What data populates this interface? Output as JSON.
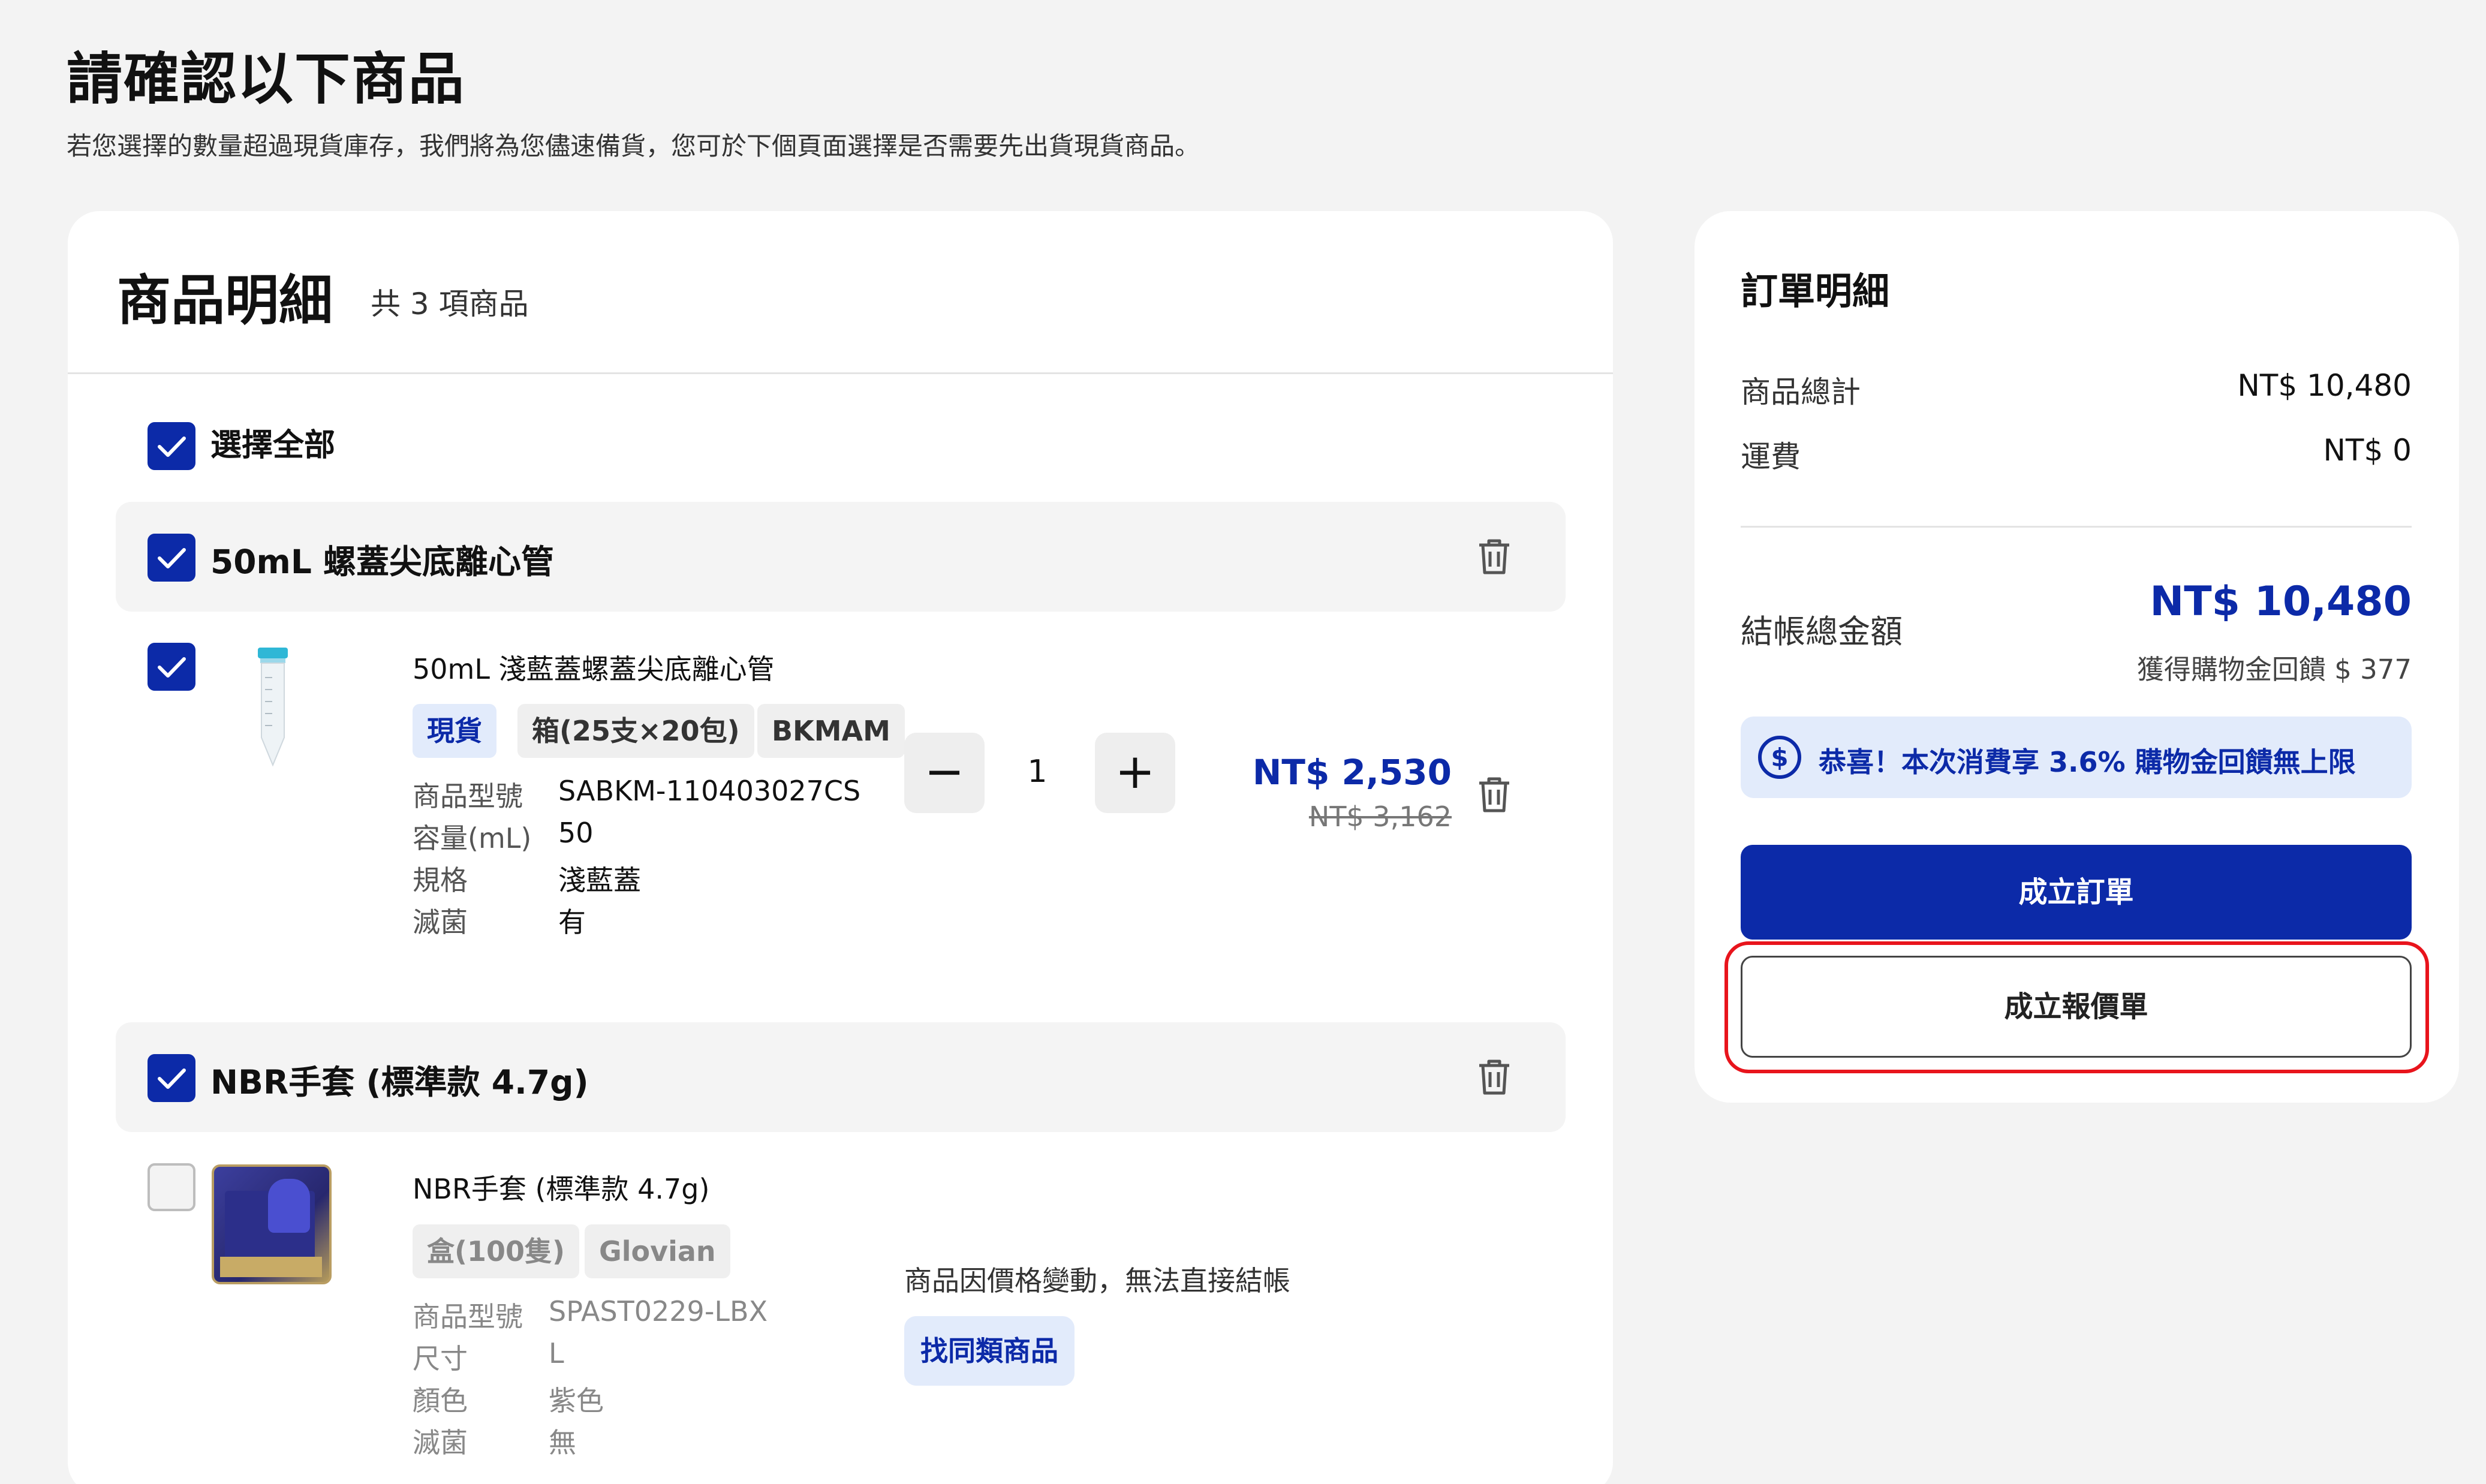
{
  "page": {
    "title": "請確認以下商品",
    "subtitle": "若您選擇的數量超過現貨庫存，我們將為您儘速備貨，您可於下個頁面選擇是否需要先出貨現貨商品。"
  },
  "cart": {
    "title": "商品明細",
    "count_text": "共 3 項商品",
    "select_all_label": "選擇全部",
    "select_all_checked": true,
    "groups": [
      {
        "title": "50mL 螺蓋尖底離心管",
        "checked": true,
        "item": {
          "name": "50mL 淺藍蓋螺蓋尖底離心管",
          "checked": true,
          "image_icon": "centrifuge-tube-icon",
          "tags": [
            "現貨",
            "箱(25支×20包)",
            "BKMAM"
          ],
          "specs": [
            {
              "label": "商品型號",
              "value": "SABKM-110403027CS"
            },
            {
              "label": "容量(mL)",
              "value": "50"
            },
            {
              "label": "規格",
              "value": "淺藍蓋"
            },
            {
              "label": "滅菌",
              "value": "有"
            }
          ],
          "quantity": "1",
          "price": "NT$ 2,530",
          "original_price": "NT$ 3,162"
        }
      },
      {
        "title": "NBR手套 (標準款 4.7g)",
        "checked": true,
        "item": {
          "name": "NBR手套 (標準款 4.7g)",
          "checked": false,
          "image_icon": "glove-box-image",
          "tags": [
            "盒(100隻)",
            "Glovian"
          ],
          "specs": [
            {
              "label": "商品型號",
              "value": "SPAST0229-LBX"
            },
            {
              "label": "尺寸",
              "value": "L"
            },
            {
              "label": "顏色",
              "value": "紫色"
            },
            {
              "label": "滅菌",
              "value": "無"
            }
          ],
          "unavailable_text": "商品因價格變動，無法直接結帳",
          "find_similar_label": "找同類商品"
        }
      }
    ]
  },
  "order": {
    "title": "訂單明細",
    "rows": [
      {
        "label": "商品總計",
        "value": "NT$ 10,480"
      },
      {
        "label": "運費",
        "value": "NT$ 0"
      }
    ],
    "total_label": "結帳總金額",
    "total_value": "NT$ 10,480",
    "cashback_note": "獲得購物金回饋 $ 377",
    "promo_text": "恭喜！本次消費享 3.6% 購物金回饋無上限",
    "create_order_label": "成立訂單",
    "create_quote_label": "成立報價單"
  },
  "colors": {
    "accent": "#0c2aa8",
    "tag_bg": "#e2ebfb",
    "highlight": "#e8141c",
    "page_bg": "#f3f3f3"
  }
}
